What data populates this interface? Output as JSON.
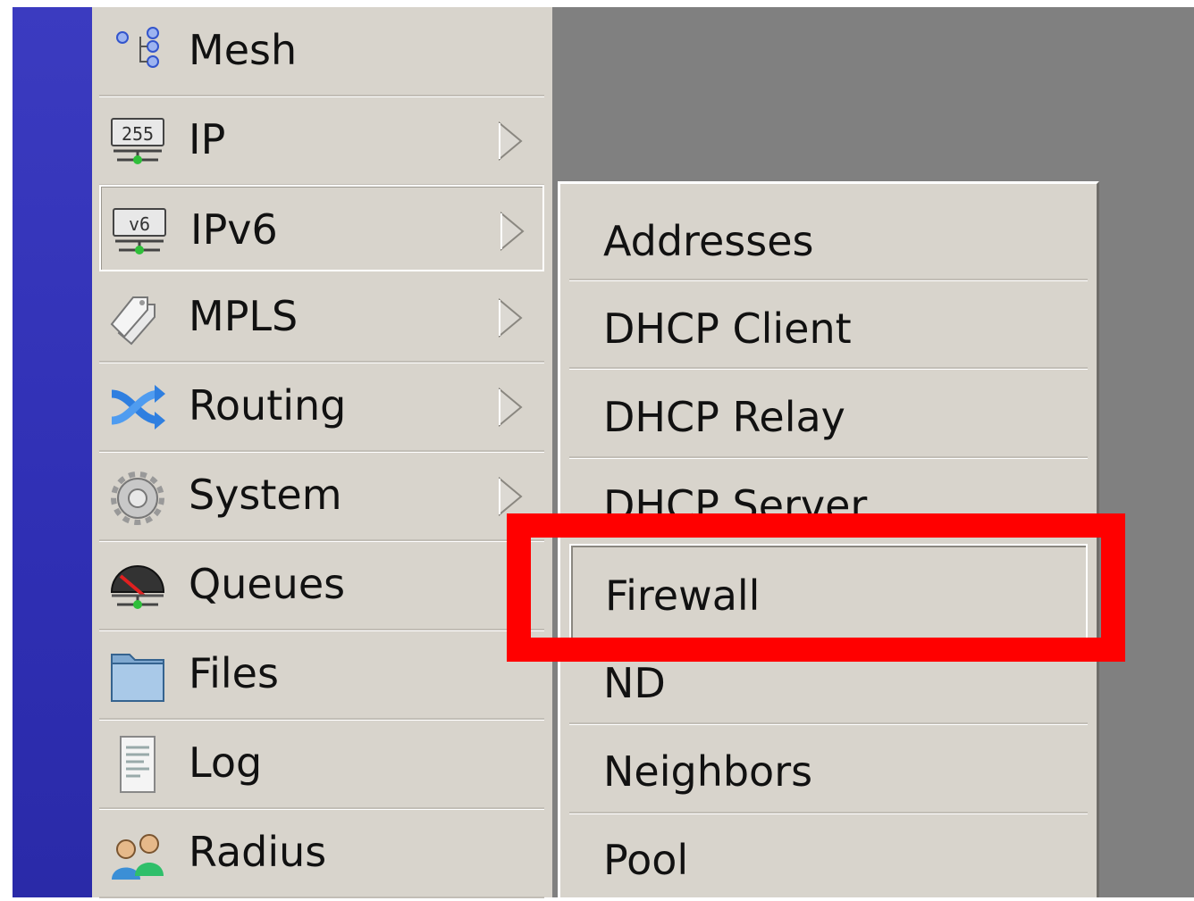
{
  "main_menu": {
    "items": [
      {
        "label": "Mesh",
        "icon": "mesh-icon",
        "has_submenu": false
      },
      {
        "label": "IP",
        "icon": "ip-icon",
        "has_submenu": true
      },
      {
        "label": "IPv6",
        "icon": "ipv6-icon",
        "has_submenu": true,
        "highlighted": true
      },
      {
        "label": "MPLS",
        "icon": "mpls-icon",
        "has_submenu": true
      },
      {
        "label": "Routing",
        "icon": "routing-icon",
        "has_submenu": true
      },
      {
        "label": "System",
        "icon": "gear-icon",
        "has_submenu": true
      },
      {
        "label": "Queues",
        "icon": "queues-icon",
        "has_submenu": false
      },
      {
        "label": "Files",
        "icon": "folder-icon",
        "has_submenu": false
      },
      {
        "label": "Log",
        "icon": "log-icon",
        "has_submenu": false
      },
      {
        "label": "Radius",
        "icon": "radius-icon",
        "has_submenu": false
      }
    ],
    "ip_icon_text": "255",
    "ipv6_icon_text": "v6"
  },
  "submenu": {
    "parent": "IPv6",
    "items": [
      {
        "label": "Addresses"
      },
      {
        "label": "DHCP Client"
      },
      {
        "label": "DHCP Relay"
      },
      {
        "label": "DHCP Server"
      },
      {
        "label": "Firewall",
        "selected": true
      },
      {
        "label": "ND"
      },
      {
        "label": "Neighbors"
      },
      {
        "label": "Pool"
      }
    ]
  },
  "annotation": {
    "color": "#ff0000",
    "target": "Firewall"
  },
  "colors": {
    "menu_bg": "#d8d4cc",
    "sidebar": "#3333bb",
    "desktop": "#808080"
  }
}
